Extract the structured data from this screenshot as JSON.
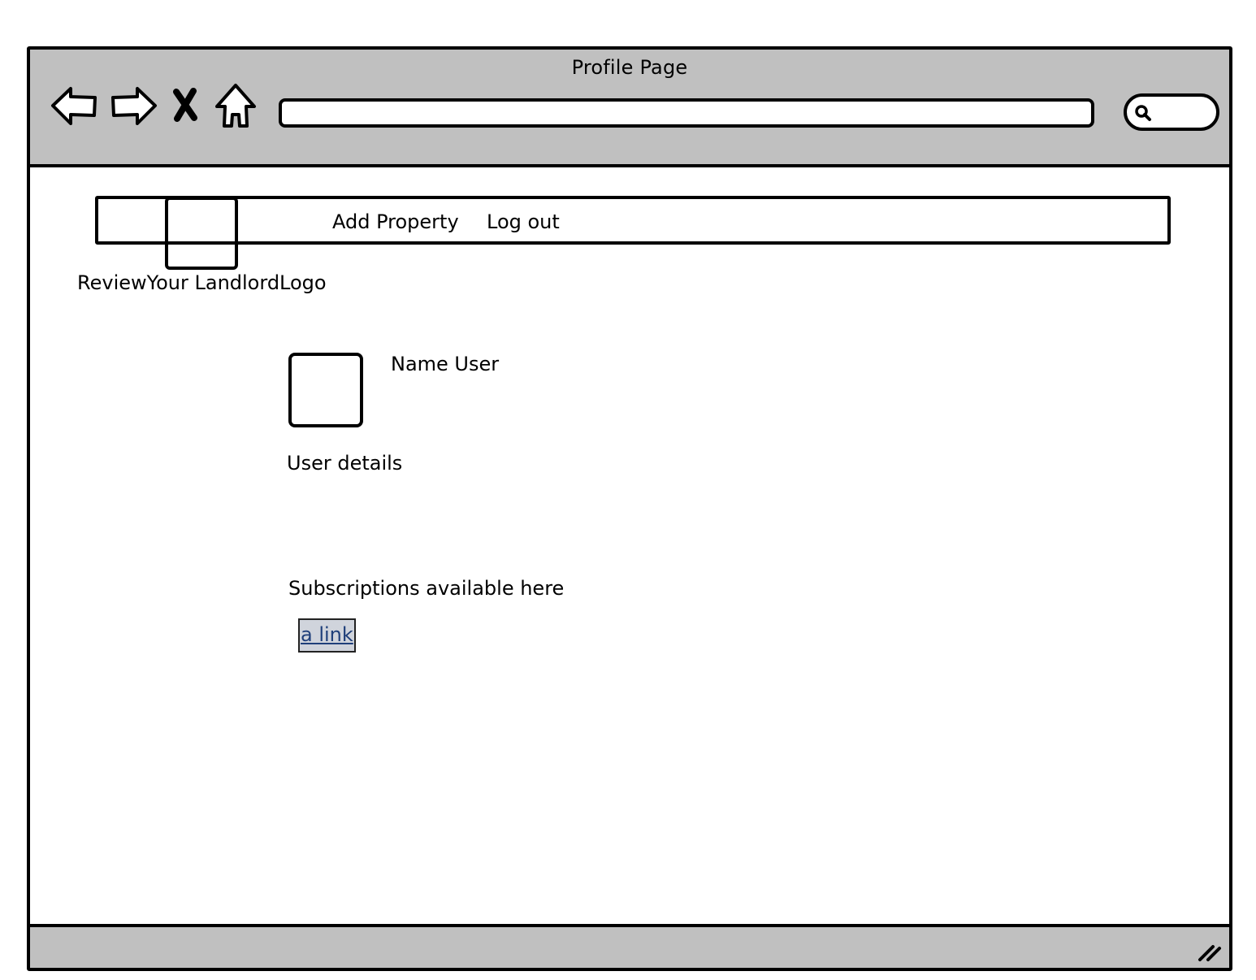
{
  "window": {
    "title": "Profile Page"
  },
  "toolbar": {
    "back_icon": "back-arrow-icon",
    "forward_icon": "forward-arrow-icon",
    "stop_icon": "close-icon",
    "home_icon": "home-icon",
    "address_value": "",
    "search_icon": "search-icon"
  },
  "navbar": {
    "links": [
      {
        "label": "Add Property"
      },
      {
        "label": "Log out"
      }
    ],
    "logo_label": "ReviewYour LandlordLogo"
  },
  "profile": {
    "name": "Name User",
    "details": "User details"
  },
  "subscriptions": {
    "text": "Subscriptions available here",
    "link_label": "a link",
    "link_highlight": "#d0d4dc",
    "link_color": "#1f3f7a"
  },
  "colors": {
    "chrome": "#c0c0c0",
    "border": "#000000",
    "background": "#ffffff"
  }
}
